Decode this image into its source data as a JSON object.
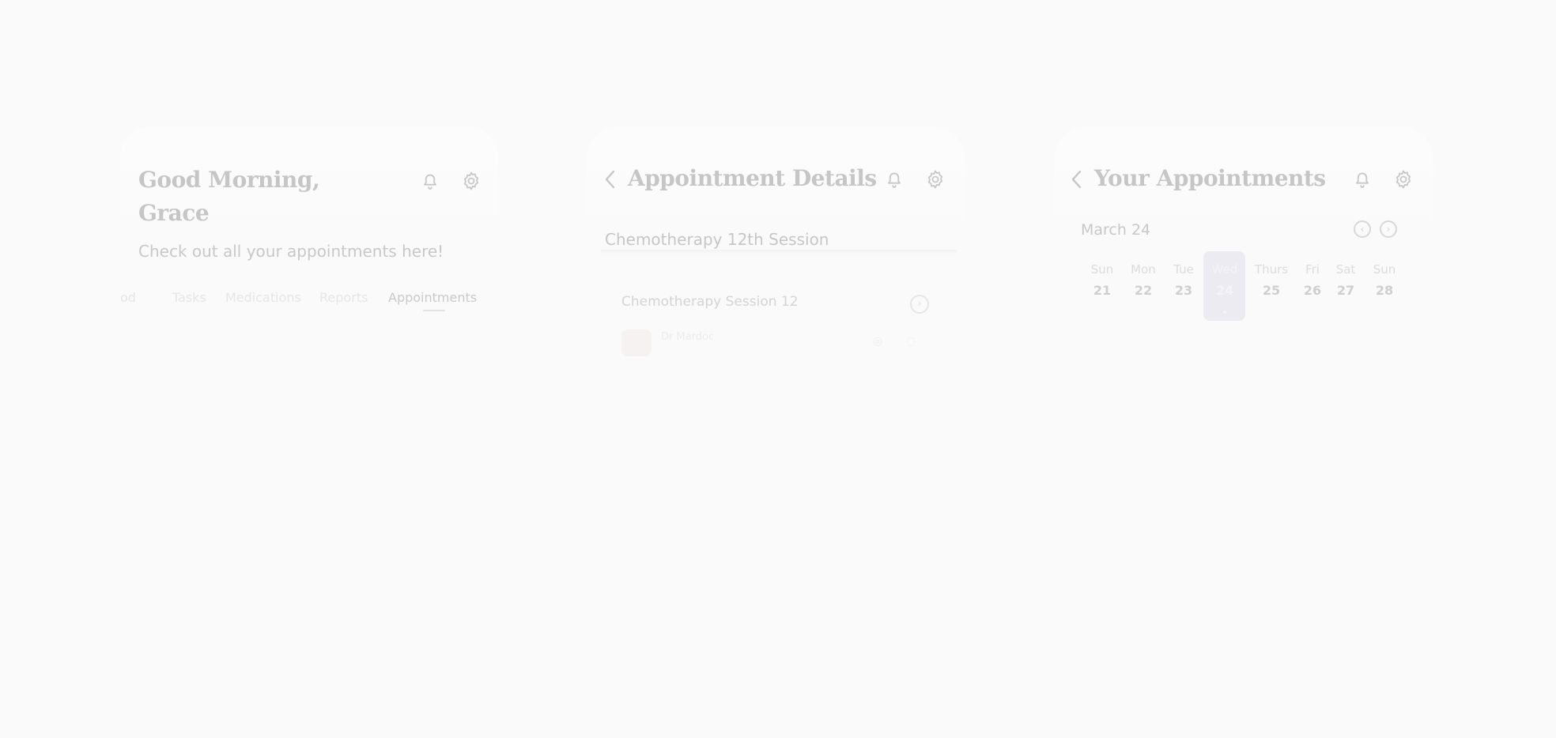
{
  "colors": {
    "background": "#fafafa",
    "title": "#c6c6c6",
    "selected_day_bg": "#ebebf1"
  },
  "home": {
    "greeting_line1": "Good Morning,",
    "greeting_line2": "Grace",
    "subtitle": "Check out all your appointments here!",
    "tabs": [
      "od",
      "Tasks",
      "Medications",
      "Reports",
      "Appointments"
    ],
    "active_tab": "Appointments",
    "icons": [
      "bell-icon",
      "gear-icon"
    ]
  },
  "details": {
    "title": "Appointment Details",
    "session_title": "Chemotherapy 12th Session",
    "card_title": "Chemotherapy Session 12",
    "doctor": "Dr Mardoc",
    "icons": [
      "back-icon",
      "bell-icon",
      "gear-icon",
      "chevron-right-icon"
    ]
  },
  "appointments": {
    "title": "Your Appointments",
    "month": "March 24",
    "days": [
      {
        "name": "Sun",
        "date": "21"
      },
      {
        "name": "Mon",
        "date": "22"
      },
      {
        "name": "Tue",
        "date": "23"
      },
      {
        "name": "Wed",
        "date": "24"
      },
      {
        "name": "Thurs",
        "date": "25"
      },
      {
        "name": "Fri",
        "date": "26"
      },
      {
        "name": "Sat",
        "date": "27"
      },
      {
        "name": "Sun",
        "date": "28"
      }
    ],
    "selected_date": "24",
    "icons": [
      "back-icon",
      "bell-icon",
      "gear-icon",
      "chevron-left-icon",
      "chevron-right-icon"
    ]
  }
}
